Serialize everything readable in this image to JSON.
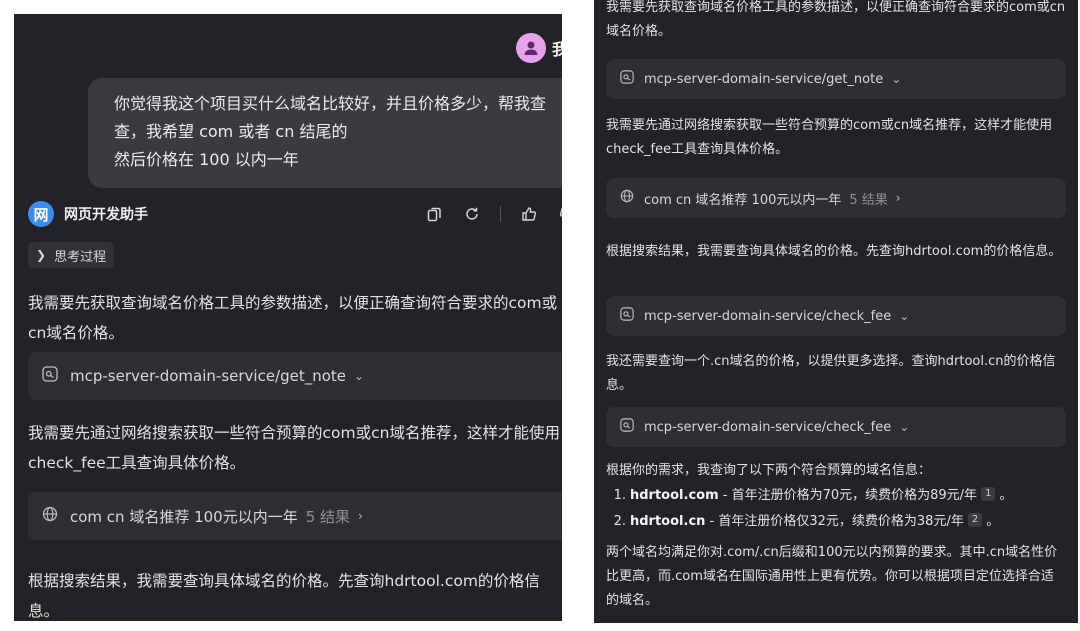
{
  "left": {
    "user_avatar_label": "我",
    "user_message": "你觉得我这个项目买什么域名比较好，并且价格多少，帮我查查，我希望 com 或者 cn 结尾的\n然后价格在 100 以内一年",
    "bot_logo": "网",
    "bot_name": "网页开发助手",
    "thinking_label": "思考过程",
    "para1": "我需要先获取查询域名价格工具的参数描述，以便正确查询符合要求的com或cn域名价格。",
    "tool1": "mcp-server-domain-service/get_note",
    "para2": "我需要先通过网络搜索获取一些符合预算的com或cn域名推荐，这样才能使用check_fee工具查询具体价格。",
    "search_query": "com cn 域名推荐 100元以内一年",
    "search_results": "5 结果",
    "para3": "根据搜索结果，我需要查询具体域名的价格。先查询hdrtool.com的价格信息。"
  },
  "right": {
    "para0": "我需要先获取查询域名价格工具的参数描述，以便正确查询符合要求的com或cn域名价格。",
    "tool1": "mcp-server-domain-service/get_note",
    "para1": "我需要先通过网络搜索获取一些符合预算的com或cn域名推荐，这样才能使用check_fee工具查询具体价格。",
    "search_query": "com cn 域名推荐 100元以内一年",
    "search_results": "5 结果",
    "para2": "根据搜索结果，我需要查询具体域名的价格。先查询hdrtool.com的价格信息。",
    "tool2": "mcp-server-domain-service/check_fee",
    "para3": "我还需要查询一个.cn域名的价格，以提供更多选择。查询hdrtool.cn的价格信息。",
    "tool3": "mcp-server-domain-service/check_fee",
    "summary_intro": "根据你的需求，我查询了以下两个符合预算的域名信息：",
    "items": [
      {
        "num": "1.",
        "domain": "hdrtool.com",
        "text": " - 首年注册价格为70元，续费价格为89元/年",
        "ref": "1",
        "end": "。"
      },
      {
        "num": "2.",
        "domain": "hdrtool.cn",
        "text": " - 首年注册价格仅32元，续费价格为38元/年",
        "ref": "2",
        "end": "。"
      }
    ],
    "conclusion": "两个域名均满足你对.com/.cn后缀和100元以内预算的要求。其中.cn域名性价比更高，而.com域名在国际通用性上更有优势。你可以根据项目定位选择合适的域名。"
  }
}
